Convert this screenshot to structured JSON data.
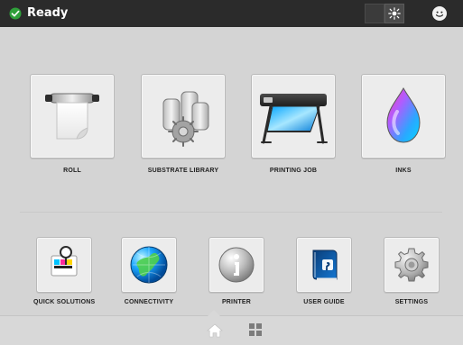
{
  "header": {
    "status_text": "Ready",
    "status_icon": "check-circle-icon",
    "brightness_icon": "brightness-icon",
    "user_icon": "user-icon"
  },
  "main_tiles": [
    {
      "label": "ROLL",
      "icon": "roll-icon"
    },
    {
      "label": "SUBSTRATE LIBRARY",
      "icon": "substrate-library-icon"
    },
    {
      "label": "PRINTING JOB",
      "icon": "printer-job-icon"
    },
    {
      "label": "INKS",
      "icon": "ink-drop-icon"
    }
  ],
  "small_tiles": [
    {
      "label": "QUICK SOLUTIONS",
      "icon": "quick-solutions-icon"
    },
    {
      "label": "CONNECTIVITY",
      "icon": "globe-icon"
    },
    {
      "label": "PRINTER",
      "icon": "info-icon"
    },
    {
      "label": "USER GUIDE",
      "icon": "user-guide-icon"
    },
    {
      "label": "SETTINGS",
      "icon": "gear-icon"
    }
  ],
  "footer": {
    "home_icon": "home-icon",
    "grid_icon": "grid-icon"
  },
  "colors": {
    "topbar": "#2b2b2b",
    "background": "#d4d4d4",
    "tile": "#ececec",
    "accent_green": "#2f9f3a"
  }
}
